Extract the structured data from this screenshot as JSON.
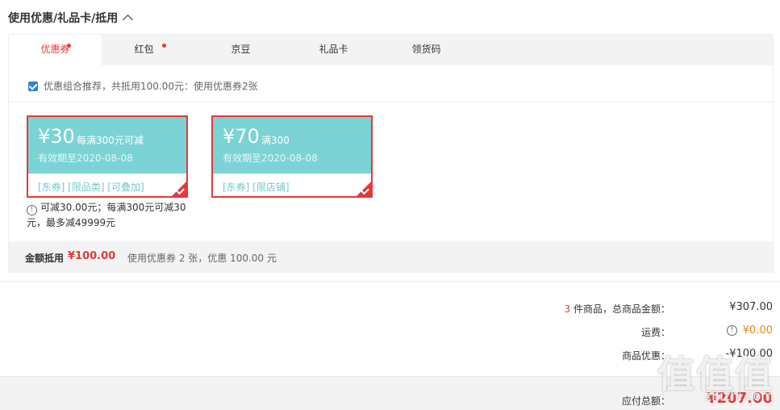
{
  "section": {
    "title": "使用优惠/礼品卡/抵用"
  },
  "tabs": [
    {
      "label": "优惠券",
      "active": true,
      "dot": true
    },
    {
      "label": "红包",
      "active": false,
      "dot": true
    },
    {
      "label": "京豆",
      "active": false,
      "dot": false
    },
    {
      "label": "礼品卡",
      "active": false,
      "dot": false
    },
    {
      "label": "领货码",
      "active": false,
      "dot": false
    }
  ],
  "recommend": {
    "text": "优惠组合推荐，共抵用100.00元：使用优惠券2张",
    "checked": true
  },
  "coupons": [
    {
      "amount": "¥30",
      "condition": "每满300元可减",
      "validity": "有效期至2020-08-08",
      "tags": "[东券]  [限品类]  [可叠加]",
      "selected": true
    },
    {
      "amount": "¥70",
      "condition": "满300",
      "validity": "有效期至2020-08-08",
      "tags": "[东券]  [限店铺]",
      "selected": true
    }
  ],
  "coupon_note": "可减30.00元；每满300元可减30元，最多减49999元",
  "summary": {
    "label": "金额抵用",
    "value": "¥100.00",
    "desc": "使用优惠券 2 张，优惠 100.00 元"
  },
  "totals": {
    "count": "3",
    "count_label": "件商品，总商品金额：",
    "goods_amount": "¥307.00",
    "shipping_label": "运费：",
    "shipping_value": "¥0.00",
    "discount_label": "商品优惠：",
    "discount_value": "-¥100.00",
    "payable_label": "应付总额：",
    "payable_value": "¥207.00"
  },
  "watermark": {
    "logo": "值值值",
    "site": "zhizhi.com"
  },
  "colors": {
    "accent": "#e4393c",
    "coupon": "#7bd3d6",
    "orange": "#e4891d"
  }
}
